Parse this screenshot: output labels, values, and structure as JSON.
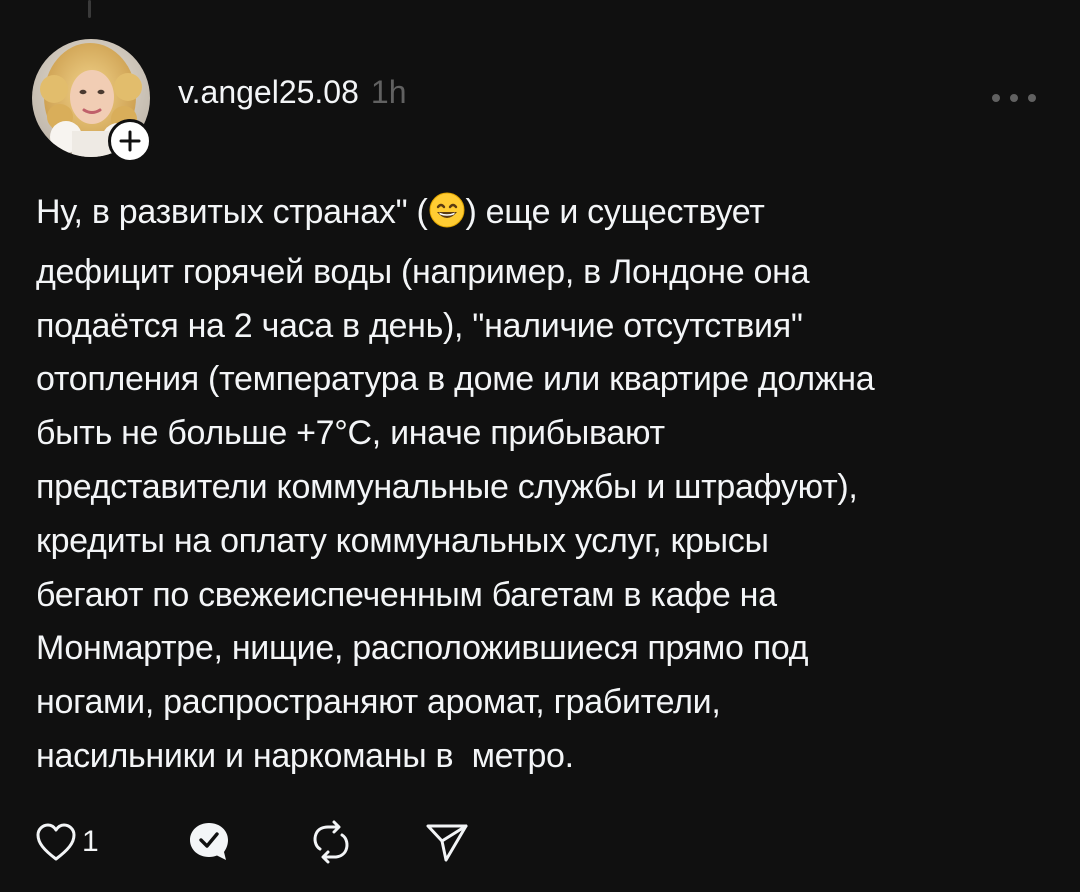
{
  "post": {
    "username": "v.angel25.08",
    "time": "1h",
    "text_lines": [
      "Ну, в развитых странах\" (",
      ") еще и существует",
      "дефицит горячей воды (например, в Лондоне она",
      "подаётся на 2 часа в день), \"наличие отсутствия\"",
      "отопления (температура в доме или квартире должна",
      "быть не больше +7°С, иначе прибывают",
      "представители коммунальные службы и штрафуют),",
      "кредиты на оплату коммунальных услуг, крысы",
      "бегают по свежеиспеченным багетам в кафе на",
      "Монмартре, нищие, расположившиеся прямо под",
      "ногами, распространяют аромат, грабители,",
      "насильники и наркоманы в  метро."
    ],
    "emoji": "grinning-smiling-eyes-emoji"
  },
  "actions": {
    "like_count": "1",
    "icons": [
      "heart-icon",
      "reply-icon",
      "repost-icon",
      "share-icon"
    ]
  },
  "colors": {
    "background": "#101010",
    "text": "#f3f5f7",
    "muted": "#616161"
  }
}
